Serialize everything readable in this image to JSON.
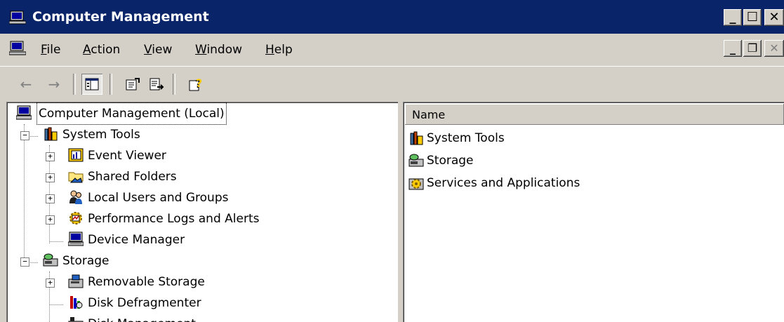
{
  "window": {
    "title": "Computer Management"
  },
  "menu": [
    {
      "key": "F",
      "rest": "ile"
    },
    {
      "key": "A",
      "rest": "ction"
    },
    {
      "key": "V",
      "rest": "iew"
    },
    {
      "key": "W",
      "rest": "indow"
    },
    {
      "key": "H",
      "rest": "elp"
    }
  ],
  "toolbar": {
    "icons": [
      "back-arrow-icon",
      "forward-arrow-icon",
      "show-hide-tree-icon",
      "properties-icon",
      "export-list-icon",
      "help-icon"
    ]
  },
  "tree": {
    "root": "Computer Management (Local)",
    "system_tools": "System Tools",
    "event_viewer": "Event Viewer",
    "shared_folders": "Shared Folders",
    "local_users": "Local Users and Groups",
    "perf_logs": "Performance Logs and Alerts",
    "device_manager": "Device Manager",
    "storage": "Storage",
    "removable_storage": "Removable Storage",
    "disk_defrag": "Disk Defragmenter",
    "disk_management": "Disk Management"
  },
  "list": {
    "column_name": "Name",
    "items": [
      "System Tools",
      "Storage",
      "Services and Applications"
    ]
  },
  "colors": {
    "titlebar": "#0a246a",
    "face": "#d4d0c8"
  }
}
